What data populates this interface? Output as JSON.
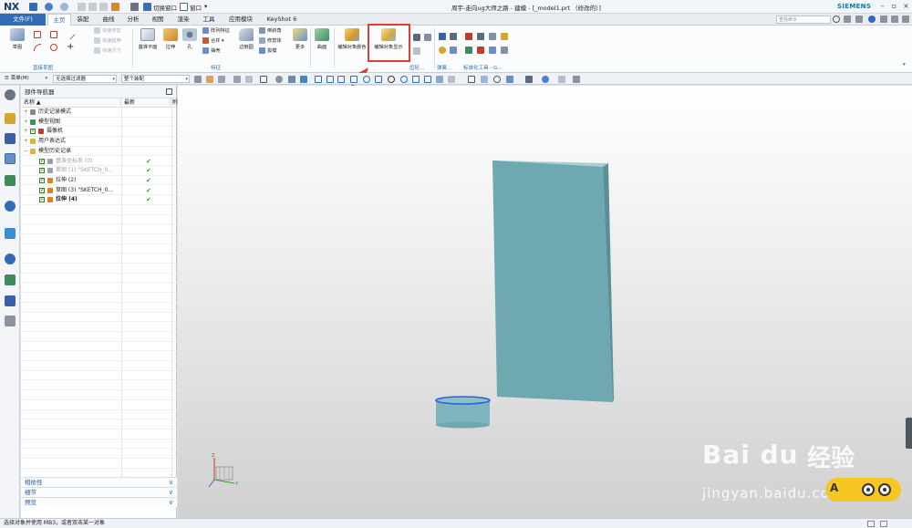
{
  "app": {
    "logo": "NX",
    "window_title": "周宇-走向ug大师之路 - 建模 - [_model1.prt （修改的）]",
    "brand": "SIEMENS"
  },
  "quick_access": {
    "switch_window_label": "切换窗口",
    "window_label": "窗口"
  },
  "tabs": {
    "file": "文件(F)",
    "items": [
      "主页",
      "装配",
      "曲线",
      "分析",
      "视图",
      "渲染",
      "工具",
      "应用模块",
      "KeyShot 6"
    ],
    "active_index": 0,
    "search_placeholder": "查找命令"
  },
  "ribbon": {
    "sketch": "草图",
    "direct_sketch_group": "直接草图",
    "quick_trim": "快速修剪",
    "quick_extend": "快速延伸",
    "quick_dimension": "快速尺寸",
    "datum_plane": "基准平面",
    "extrude": "拉伸",
    "hole": "孔",
    "pattern_feature": "阵列特征",
    "unite": "合并",
    "shell": "抽壳",
    "edge_blend": "边倒圆",
    "chamfer": "倒斜角",
    "trim_body": "修剪体",
    "draft": "拔模",
    "more": "更多",
    "feature_group": "特征",
    "surface": "曲面",
    "edit_object_color": "编辑对象颜色",
    "edit_object_display": "编辑对象显示",
    "sync_modeling_group": "齿轮...",
    "spring_group": "弹簧...",
    "standard_tools_group": "标准化工具 - G..."
  },
  "selection_bar": {
    "menu_label": "菜单(M)",
    "filter_value": "无选择过滤器",
    "scope_value": "整个装配"
  },
  "navigator": {
    "title": "部件导航器",
    "col_name": "名称",
    "col_latest": "最新",
    "col_extra": "附",
    "rows": [
      {
        "label": "历史记录模式",
        "indent": 0,
        "icon_color": "#888888",
        "check": false,
        "ok": false,
        "bold": false,
        "grey": false
      },
      {
        "label": "模型视图",
        "indent": 0,
        "icon_color": "#3f8f5a",
        "check": false,
        "ok": false,
        "bold": false,
        "grey": false
      },
      {
        "label": "摄像机",
        "indent": 0,
        "icon_color": "#c23b2f",
        "check": true,
        "ok": false,
        "bold": false,
        "grey": false
      },
      {
        "label": "用户表达式",
        "indent": 0,
        "icon_color": "#e2b23c",
        "check": false,
        "ok": false,
        "bold": false,
        "grey": false
      },
      {
        "label": "模型历史记录",
        "indent": 0,
        "icon_color": "#e2b23c",
        "check": false,
        "ok": false,
        "bold": false,
        "grey": false
      },
      {
        "label": "基准坐标系 (0)",
        "indent": 1,
        "icon_color": "#9aa3ad",
        "check": true,
        "ok": true,
        "bold": false,
        "grey": true
      },
      {
        "label": "草图 (1) \"SKETCH_0...",
        "indent": 1,
        "icon_color": "#9aa3ad",
        "check": true,
        "ok": true,
        "bold": false,
        "grey": true
      },
      {
        "label": "拉伸 (2)",
        "indent": 1,
        "icon_color": "#e07f2a",
        "check": true,
        "ok": true,
        "bold": false,
        "grey": false
      },
      {
        "label": "草图 (3) \"SKETCH_0...",
        "indent": 1,
        "icon_color": "#e07f2a",
        "check": true,
        "ok": true,
        "bold": false,
        "grey": false
      },
      {
        "label": "拉伸 (4)",
        "indent": 1,
        "icon_color": "#e07f2a",
        "check": true,
        "ok": true,
        "bold": true,
        "grey": false
      }
    ],
    "sections": [
      "相依性",
      "细节",
      "预览"
    ]
  },
  "viewport": {
    "model_color": "#6ea8b1",
    "highlight_edge_color": "#2f62d6",
    "triad": {
      "x": "X",
      "y": "Y",
      "z": "Z"
    }
  },
  "status": {
    "message": "选择对象并使用 MB3，或者双击某一对象"
  },
  "watermark": {
    "logo": "Bai du",
    "jingyan": "经验",
    "url": "jingyan.baidu.com",
    "mascot_letter": "A"
  },
  "colors": {
    "accent": "#2f6db7",
    "annotation_red": "#e23d32",
    "ok_green": "#2ea02a"
  }
}
